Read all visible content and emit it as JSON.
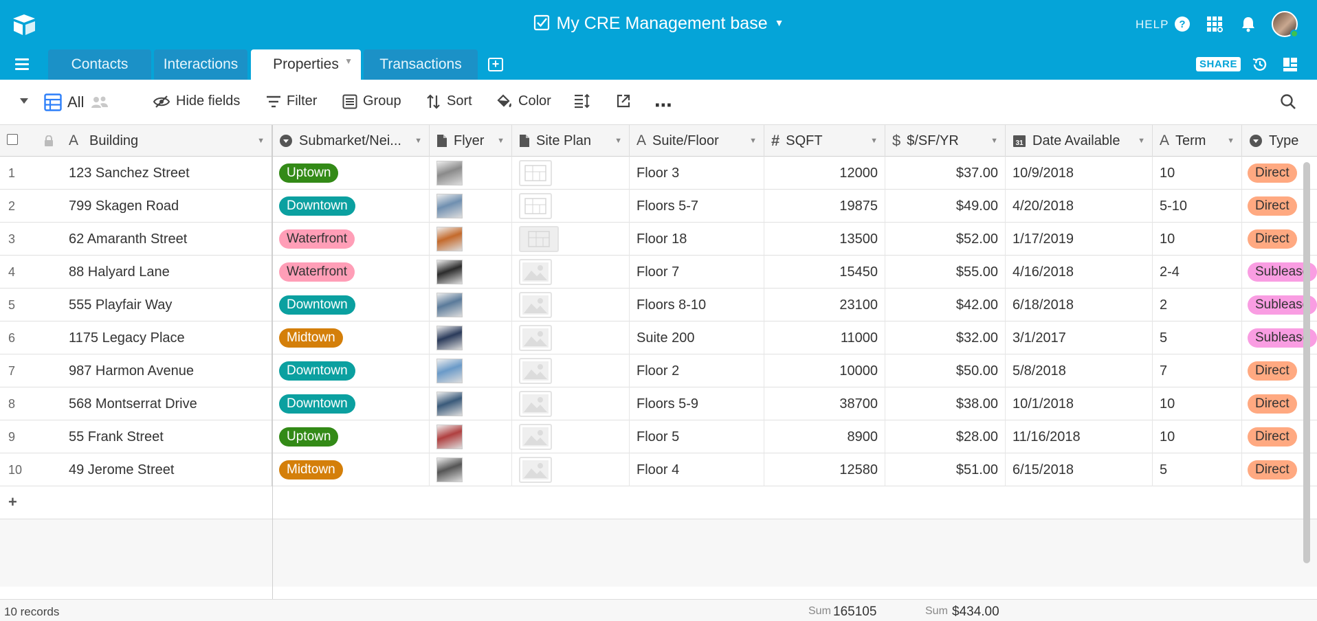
{
  "header": {
    "title": "My CRE Management base",
    "help": "HELP",
    "icons": [
      "help-icon",
      "apps-grid-icon",
      "notifications-bell-icon"
    ]
  },
  "tabs": [
    {
      "label": "Contacts"
    },
    {
      "label": "Interactions"
    },
    {
      "label": "Properties",
      "active": true
    },
    {
      "label": "Transactions"
    }
  ],
  "share_label": "SHARE",
  "toolbar": {
    "view": "All",
    "hide_fields": "Hide fields",
    "filter": "Filter",
    "group": "Group",
    "sort": "Sort",
    "color": "Color"
  },
  "columns": {
    "building": "Building",
    "submarket": "Submarket/Nei...",
    "flyer": "Flyer",
    "site_plan": "Site Plan",
    "suite": "Suite/Floor",
    "sqft": "SQFT",
    "rate": "$/SF/YR",
    "date": "Date Available",
    "term": "Term",
    "type": "Type"
  },
  "rows": [
    {
      "num": "1",
      "building": "123 Sanchez Street",
      "submarket": "Uptown",
      "suite": "Floor 3",
      "sqft": "12000",
      "rate": "$37.00",
      "date": "10/9/2018",
      "term": "10",
      "type": "Direct"
    },
    {
      "num": "2",
      "building": "799 Skagen Road",
      "submarket": "Downtown",
      "suite": "Floors 5-7",
      "sqft": "19875",
      "rate": "$49.00",
      "date": "4/20/2018",
      "term": "5-10",
      "type": "Direct"
    },
    {
      "num": "3",
      "building": "62 Amaranth Street",
      "submarket": "Waterfront",
      "suite": "Floor 18",
      "sqft": "13500",
      "rate": "$52.00",
      "date": "1/17/2019",
      "term": "10",
      "type": "Direct"
    },
    {
      "num": "4",
      "building": "88 Halyard Lane",
      "submarket": "Waterfront",
      "suite": "Floor 7",
      "sqft": "15450",
      "rate": "$55.00",
      "date": "4/16/2018",
      "term": "2-4",
      "type": "Sublease"
    },
    {
      "num": "5",
      "building": "555 Playfair Way",
      "submarket": "Downtown",
      "suite": "Floors 8-10",
      "sqft": "23100",
      "rate": "$42.00",
      "date": "6/18/2018",
      "term": "2",
      "type": "Sublease"
    },
    {
      "num": "6",
      "building": "1175 Legacy Place",
      "submarket": "Midtown",
      "suite": "Suite 200",
      "sqft": "11000",
      "rate": "$32.00",
      "date": "3/1/2017",
      "term": "5",
      "type": "Sublease"
    },
    {
      "num": "7",
      "building": "987 Harmon Avenue",
      "submarket": "Downtown",
      "suite": "Floor 2",
      "sqft": "10000",
      "rate": "$50.00",
      "date": "5/8/2018",
      "term": "7",
      "type": "Direct"
    },
    {
      "num": "8",
      "building": "568 Montserrat Drive",
      "submarket": "Downtown",
      "suite": "Floors 5-9",
      "sqft": "38700",
      "rate": "$38.00",
      "date": "10/1/2018",
      "term": "10",
      "type": "Direct"
    },
    {
      "num": "9",
      "building": "55 Frank Street",
      "submarket": "Uptown",
      "suite": "Floor 5",
      "sqft": "8900",
      "rate": "$28.00",
      "date": "11/16/2018",
      "term": "10",
      "type": "Direct"
    },
    {
      "num": "10",
      "building": "49 Jerome Street",
      "submarket": "Midtown",
      "suite": "Floor 4",
      "sqft": "12580",
      "rate": "$51.00",
      "date": "6/15/2018",
      "term": "5",
      "type": "Direct"
    }
  ],
  "pill_colors": {
    "Uptown": {
      "bg": "#338A17",
      "fg": "#ffffff"
    },
    "Downtown": {
      "bg": "#0BA0A0",
      "fg": "#ffffff"
    },
    "Waterfront": {
      "bg": "#FF9EB7",
      "fg": "#333333"
    },
    "Midtown": {
      "bg": "#D47F0A",
      "fg": "#ffffff"
    },
    "Direct": {
      "bg": "#FFA981",
      "fg": "#333333"
    },
    "Sublease": {
      "bg": "#F99DE2",
      "fg": "#333333"
    }
  },
  "footer": {
    "records": "10 records",
    "sum_label": "Sum",
    "sqft_sum": "165105",
    "rate_sum": "$434.00"
  }
}
